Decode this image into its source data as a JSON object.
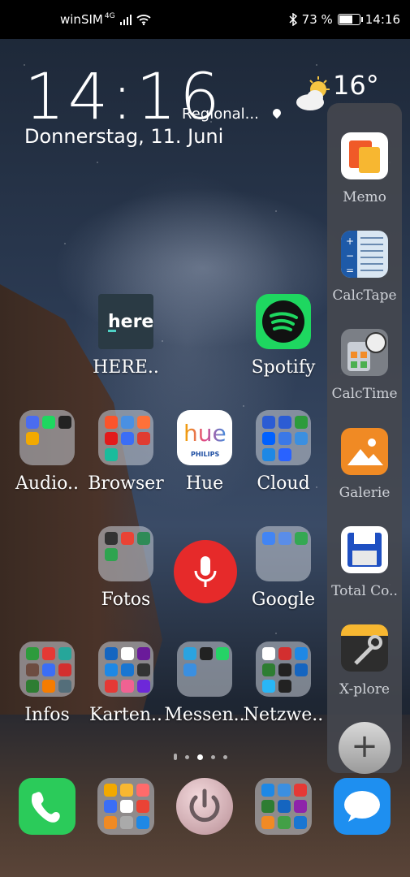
{
  "status_bar": {
    "carrier": "winSIM",
    "network": "4G",
    "battery_percent": "73 %",
    "battery_level": 0.73,
    "time": "14:16"
  },
  "clock_widget": {
    "time": "14:16",
    "location": "Regional...",
    "date": "Donnerstag, 11. Juni",
    "temperature": "16°",
    "weather_icon": "partly-cloudy-icon"
  },
  "home": {
    "row1": [
      {
        "label": "HERE..",
        "icon": "here-wego-icon",
        "color": "#2a3a44"
      },
      {
        "label": "Spotify",
        "icon": "spotify-icon",
        "color": "#1ed760"
      }
    ],
    "row2": [
      {
        "label": "Audio..",
        "icon": "folder-icon"
      },
      {
        "label": "Browser",
        "icon": "folder-icon"
      },
      {
        "label": "Hue",
        "icon": "hue-icon",
        "icon_text": "hue",
        "icon_sub": "PHILIPS"
      },
      {
        "label": "Cloud",
        "icon": "folder-icon"
      }
    ],
    "row3": [
      {
        "label": "Fotos",
        "icon": "folder-icon"
      },
      {
        "label": "Google",
        "icon": "folder-icon"
      }
    ],
    "row4": [
      {
        "label": "Infos",
        "icon": "folder-icon"
      },
      {
        "label": "Karten..",
        "icon": "folder-icon"
      },
      {
        "label": "Messen..",
        "icon": "folder-icon"
      },
      {
        "label": "Netzwe..",
        "icon": "folder-icon"
      }
    ],
    "voice_button_icon": "microphone-icon",
    "page_count": 5,
    "active_page": 3
  },
  "side_panel": {
    "apps": [
      {
        "label": "Memo",
        "icon": "memo-icon",
        "color": "#ffffff"
      },
      {
        "label": "CalcTape",
        "icon": "calctape-icon",
        "color": "#d9e6f2"
      },
      {
        "label": "CalcTime",
        "icon": "calctime-icon",
        "color": "#7b7f86"
      },
      {
        "label": "Galerie",
        "icon": "gallery-icon",
        "color": "#f08a24"
      },
      {
        "label": "Total Co..",
        "icon": "floppy-disk-icon",
        "color": "#ffffff"
      },
      {
        "label": "X-plore",
        "icon": "xplore-icon",
        "color": "#2d2d2d"
      }
    ],
    "add_label": "+"
  },
  "dock": {
    "items": [
      {
        "icon": "phone-icon",
        "color": "#2bcb5a"
      },
      {
        "icon": "folder-icon"
      },
      {
        "icon": "power-icon"
      },
      {
        "icon": "folder-icon"
      },
      {
        "icon": "messages-icon",
        "color": "#1e8ff0"
      }
    ]
  }
}
